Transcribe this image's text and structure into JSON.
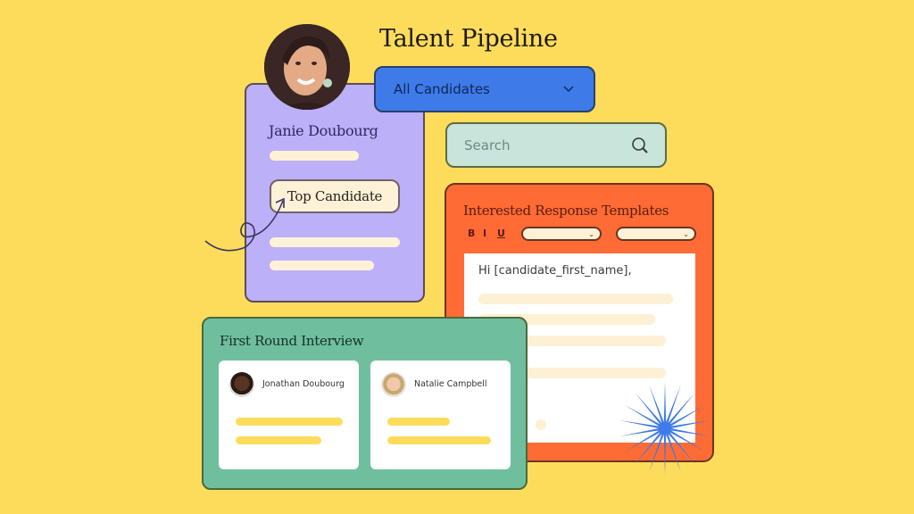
{
  "header": {
    "title": "Talent Pipeline"
  },
  "filter": {
    "selected": "All Candidates",
    "chevron_icon": "chevron-down-icon"
  },
  "search": {
    "placeholder": "Search",
    "icon": "search-icon"
  },
  "profile": {
    "name": "Janie Doubourg",
    "badge": "Top Candidate"
  },
  "templates": {
    "title": "Interested Response Templates",
    "format_bold": "B",
    "format_italic": "I",
    "format_underline": "U",
    "editor_greeting": "Hi [candidate_first_name],"
  },
  "interview": {
    "title": "First Round Interview",
    "candidates": [
      {
        "name": "Jonathan Doubourg"
      },
      {
        "name": "Natalie Campbell"
      }
    ]
  },
  "colors": {
    "background": "#fddc5c",
    "profile_card": "#bcb0f8",
    "dropdown": "#3e7be8",
    "search": "#c9e4da",
    "templates_panel": "#ff6b35",
    "interview_panel": "#6fbf9f",
    "starburst": "#3e7be8"
  }
}
